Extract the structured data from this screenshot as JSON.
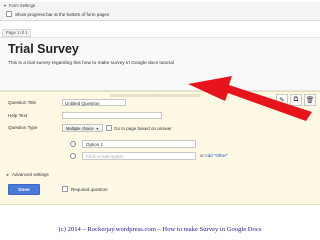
{
  "settings": {
    "header": "Form Settings",
    "progress_bar_label": "Show progress bar at the bottom of form pages"
  },
  "page_label": "Page 1 of 1",
  "form": {
    "title": "Trial Survey",
    "description": "This is a trial survey regarding this how to make survey in Google docs tutorial"
  },
  "question": {
    "drag_label": "::::",
    "title_label": "Question Title",
    "title_value": "Untitled Question",
    "help_label": "Help Text",
    "help_value": "",
    "type_label": "Question Type",
    "type_value": "Multiple choice",
    "goto_page_label": "Go to page based on answer",
    "option1": "Option 1",
    "add_option_placeholder": "Click to add option",
    "or_text": "or",
    "add_other_text": "Add \"Other\"",
    "advanced_settings": "Advanced settings",
    "done_label": "Done",
    "required_label": "Required question"
  },
  "tools": {
    "edit": "✎",
    "duplicate": "⧉",
    "delete": "🗑"
  },
  "colors": {
    "question_bg": "#fdf9e4",
    "arrow": "#e8141c",
    "done_button": "#4a7ad9",
    "caption": "#1a1a8c"
  },
  "copyright": "(c) 2014 – Rockerjay.wordpress.com – How to make Survey in Google Docs"
}
